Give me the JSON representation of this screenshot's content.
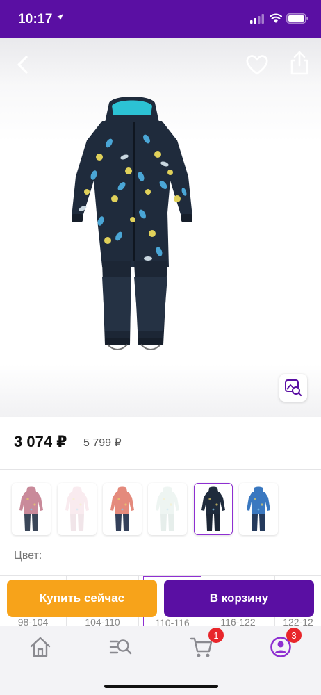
{
  "status_bar": {
    "time": "10:17"
  },
  "product": {
    "price_current": "3 074 ₽",
    "price_old": "5 799 ₽"
  },
  "variants": [
    {
      "name": "pink-floral",
      "selected": false,
      "faded": false
    },
    {
      "name": "light-pink",
      "selected": false,
      "faded": true
    },
    {
      "name": "coral-floral",
      "selected": false,
      "faded": false
    },
    {
      "name": "light-mint",
      "selected": false,
      "faded": true
    },
    {
      "name": "navy-birds",
      "selected": true,
      "faded": false
    },
    {
      "name": "blue-print",
      "selected": false,
      "faded": false
    }
  ],
  "color_label": "Цвет:",
  "sizes": [
    "98-104",
    "104-110",
    "110-116",
    "116-122",
    "122-12"
  ],
  "actions": {
    "buy_now": "Купить сейчас",
    "add_to_cart": "В корзину"
  },
  "tabbar": {
    "cart_badge": "1",
    "profile_badge": "3"
  },
  "colors": {
    "brand_purple": "#5a0fa3",
    "buy_orange": "#f7a31a",
    "badge_red": "#e8262b"
  }
}
